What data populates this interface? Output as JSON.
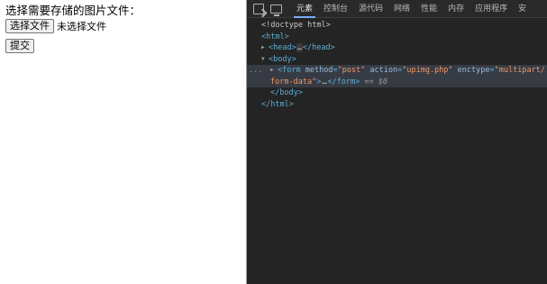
{
  "page": {
    "prompt": "选择需要存储的图片文件：",
    "choose_file_label": "选择文件",
    "no_file_label": "未选择文件",
    "submit_label": "提交"
  },
  "devtools": {
    "tabs": [
      {
        "label": "元素",
        "active": true
      },
      {
        "label": "控制台"
      },
      {
        "label": "源代码"
      },
      {
        "label": "网络"
      },
      {
        "label": "性能"
      },
      {
        "label": "内存"
      },
      {
        "label": "应用程序"
      },
      {
        "label": "安"
      }
    ],
    "tree": {
      "doctype": "<!doctype html>",
      "html_open": "<html>",
      "head_open": "<head>",
      "head_ellipsis": "…",
      "head_close": "</head>",
      "body_open": "<body>",
      "form_tag": "<form",
      "form_attr1_name": "method",
      "form_attr1_value": "\"post\"",
      "form_attr2_name": "action",
      "form_attr2_value": "\"upimg.php\"",
      "form_attr3_name": "enctype",
      "form_attr3_value_a": "\"multipart/",
      "form_attr3_value_b": "form-data\"",
      "form_gt": ">",
      "form_ellipsis": "…",
      "form_close": "</form>",
      "eq_dollar": "== $0",
      "body_close": "</body>",
      "html_close": "</html>",
      "dots": "..."
    },
    "icons": {
      "inspect": "inspect-element-icon",
      "device": "device-toolbar-icon"
    },
    "colors": {
      "background": "#242424",
      "tag": "#5db0d7",
      "attr_name": "#9bbbdc",
      "attr_value": "#f29766",
      "active_tab_underline": "#7cacf8"
    }
  }
}
